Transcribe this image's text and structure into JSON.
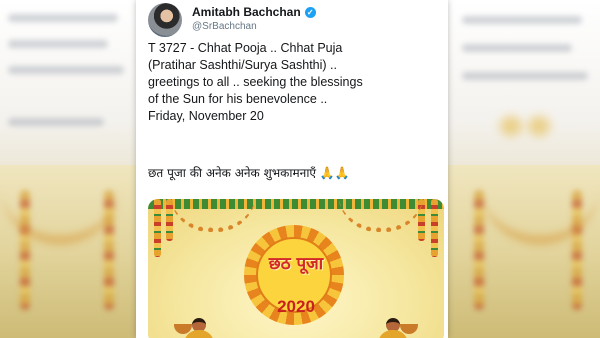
{
  "tweet": {
    "author_name": "Amitabh Bachchan",
    "handle": "@SrBachchan",
    "text_lines": [
      "T 3727 - Chhat Pooja  .. Chhat Puja",
      "(Pratihar Sashthi/Surya Sashthi) ..",
      "greetings to all .. seeking the blessings",
      "of the Sun for his benevolence ..",
      "Friday, November 20"
    ],
    "hindi_line": "छत पूजा की अनेक अनेक शुभकामनाएँ",
    "emoji": "🙏🙏"
  },
  "media": {
    "title": "छठ पूजा",
    "year": "2020"
  },
  "colors": {
    "verified": "#1da1f2",
    "handle": "#657786",
    "text": "#14171a",
    "title_red": "#d3282a",
    "sun_orange": "#e8841d",
    "sun_yellow": "#f7c53c"
  },
  "icons": [
    "verified-badge-icon",
    "folded-hands-icon"
  ]
}
